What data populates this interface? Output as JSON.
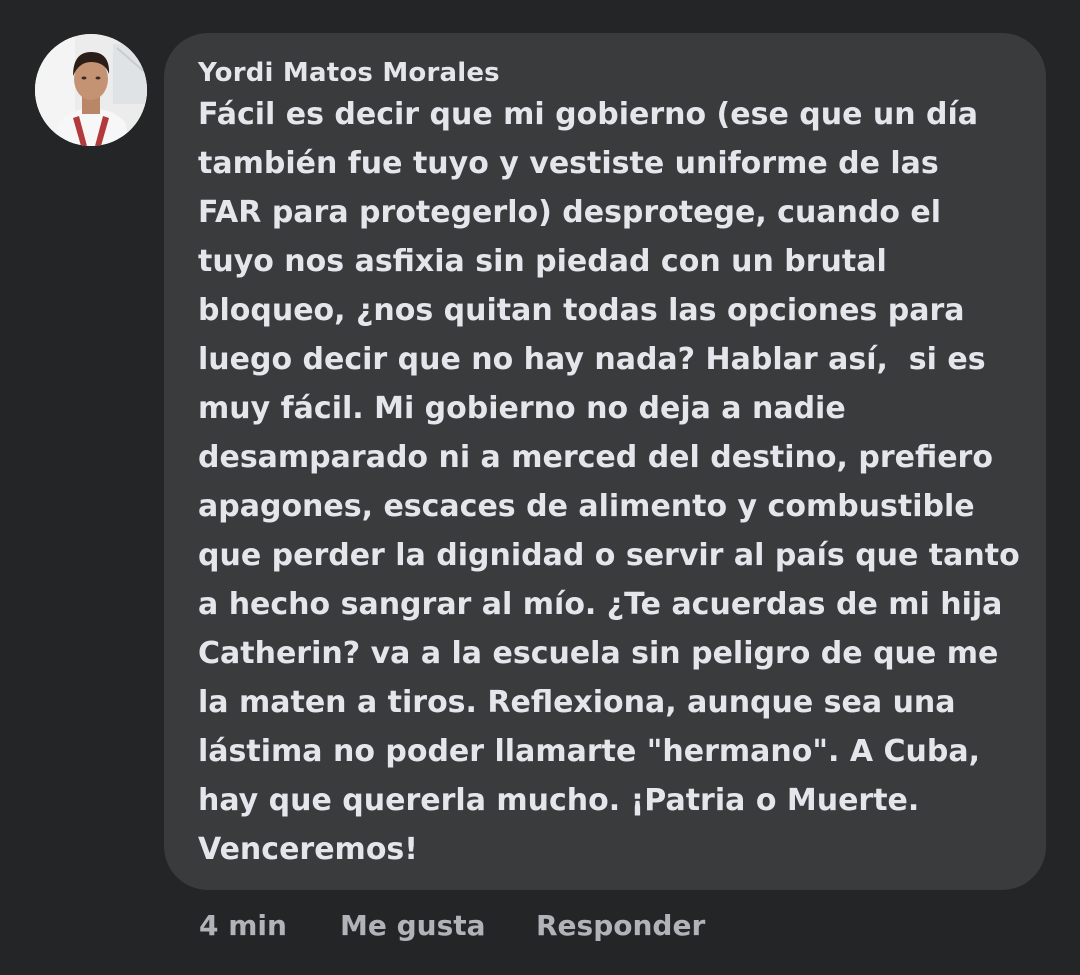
{
  "comment": {
    "author": "Yordi Matos Morales",
    "lines": [
      "Fácil es decir que mi gobierno (ese que un día",
      "también fue tuyo y vestiste uniforme de las",
      "FAR para protegerlo) desprotege, cuando el",
      "tuyo nos asfixia sin piedad con un brutal",
      "bloqueo, ¿nos quitan todas las opciones para",
      "luego decir que no hay nada? Hablar así,  si es",
      "muy fácil. Mi gobierno no deja a nadie",
      "desamparado ni a merced del destino, prefiero",
      "apagones, escaces de alimento y combustible",
      "que perder la dignidad o servir al país que tanto",
      "a hecho sangrar al mío. ¿Te acuerdas de mi hija",
      "Catherin? va a la escuela sin peligro de que me",
      "la maten a tiros. Reflexiona, aunque sea una",
      "lástima no poder llamarte \"hermano\". A Cuba,",
      "hay que quererla mucho. ¡Patria o Muerte.",
      "Venceremos!"
    ]
  },
  "actions": {
    "time": "4 min",
    "like_label": "Me gusta",
    "reply_label": "Responder"
  },
  "colors": {
    "background": "#242526",
    "bubble": "#3a3b3c",
    "text": "#e4e6eb",
    "secondary_text": "#b0b3b8"
  }
}
